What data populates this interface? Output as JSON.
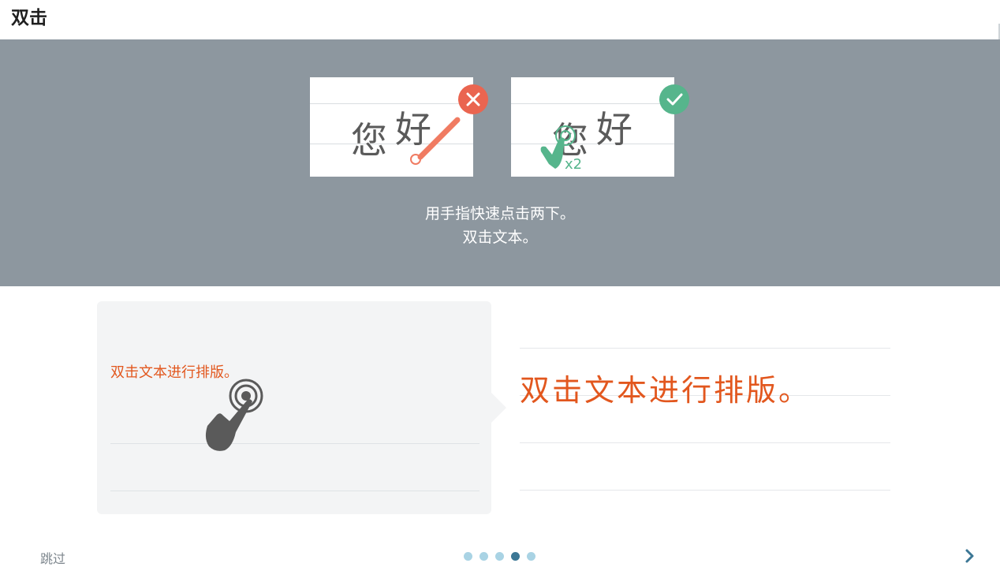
{
  "header": {
    "title": "双击"
  },
  "banner": {
    "wrong_card": {
      "glyph1": "您",
      "glyph2": "好",
      "badge_icon": "close-icon"
    },
    "right_card": {
      "glyph1": "您",
      "glyph2": "好",
      "tap_count": "x2",
      "badge_icon": "check-icon"
    },
    "instruction_line1": "用手指快速点击两下。",
    "instruction_line2": "双击文本。",
    "colors": {
      "background": "#8d979f",
      "wrong": "#ea6550",
      "right": "#56b58c"
    }
  },
  "example": {
    "text": "双击文本进行排版。",
    "hand_icon": "double-tap-hand-icon"
  },
  "result": {
    "text": "双击文本进行排版。",
    "color": "#e2571e"
  },
  "footer": {
    "skip_label": "跳过",
    "pages": 5,
    "active_page": 4,
    "next_icon": "chevron-right-icon"
  }
}
